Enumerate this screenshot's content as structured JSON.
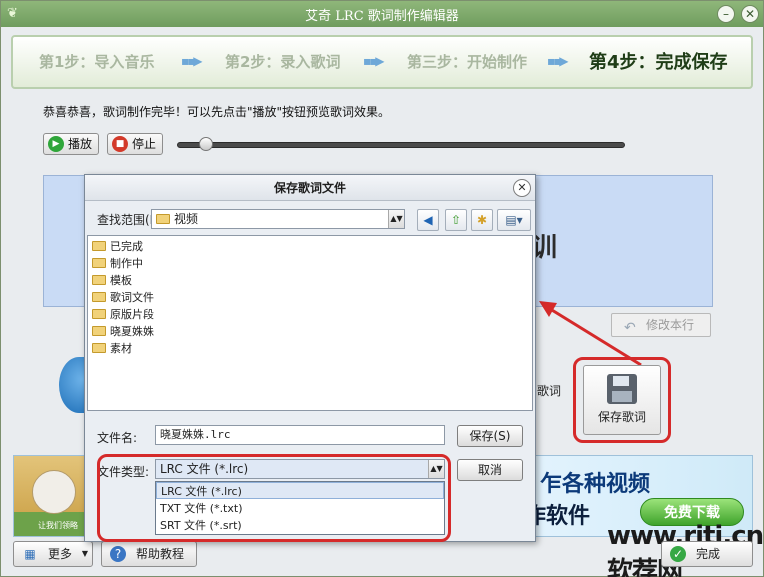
{
  "window": {
    "title": "艾奇 LRC 歌词制作编辑器"
  },
  "steps": [
    {
      "label": "第1步：导入音乐"
    },
    {
      "label": "第2步：录入歌词"
    },
    {
      "label": "第三步：开始制作"
    },
    {
      "label": "第4步：完成保存",
      "active": true
    }
  ],
  "message": "恭喜恭喜，歌词制作完毕！可以先点击\"播放\"按钮预览歌词效果。",
  "controls": {
    "play": "播放",
    "stop": "停止",
    "progress": 0.06
  },
  "preview": {
    "visible_char": "训"
  },
  "modify_line": "修改本行",
  "side_label": "歌词",
  "save_lyrics": "保存歌词",
  "banner": {
    "line1": "乍各种视频",
    "line2": "相册制作软件",
    "free_download": "免费下载",
    "small_caption": "让我们领略"
  },
  "watermark": "www.rjtj.cn软荐网",
  "bottom": {
    "more": "更多",
    "help": "帮助教程",
    "finish": "完成"
  },
  "dialog": {
    "title": "保存歌词文件",
    "look_in_label": "查找范围(I):",
    "look_in_value": "视频",
    "folders": [
      "已完成",
      "制作中",
      "模板",
      "歌词文件",
      "原版片段",
      "晓夏姝姝",
      "素材"
    ],
    "filename_label": "文件名:",
    "filename_value": "晓夏姝姝.lrc",
    "filetype_label": "文件类型:",
    "filetype_value": "LRC 文件 (*.lrc)",
    "filetype_options": [
      "LRC 文件 (*.lrc)",
      "TXT 文件 (*.txt)",
      "SRT 文件 (*.srt)"
    ],
    "save_button": "保存(S)",
    "cancel_button": "取消"
  }
}
